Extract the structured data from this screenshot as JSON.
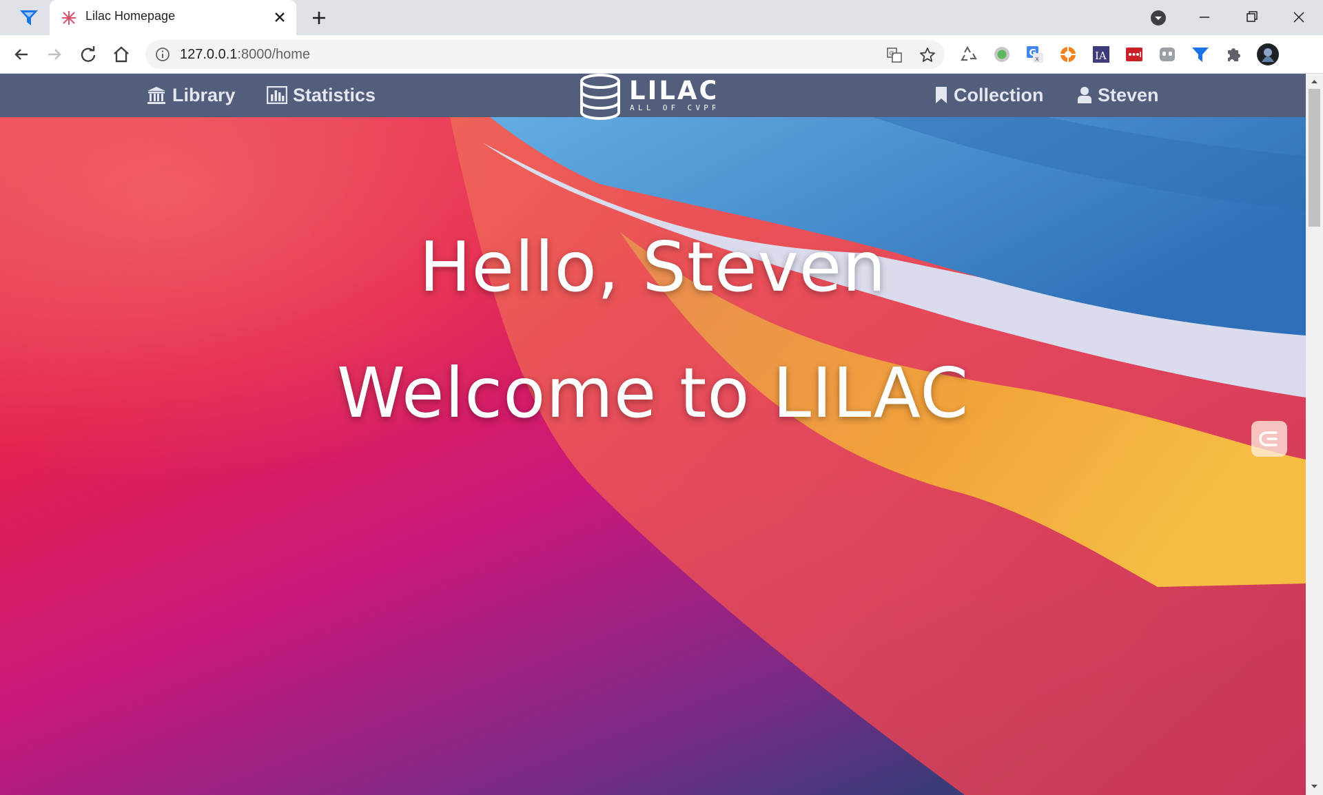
{
  "browser": {
    "tab": {
      "title": "Lilac Homepage"
    },
    "address": {
      "host": "127.0.0.1",
      "rest": ":8000/home"
    }
  },
  "icons": {
    "app": "funnel-icon",
    "favicon": "lilac-favicon-icon",
    "extensions": [
      "recycle-icon",
      "green-circle-icon",
      "google-translate-icon",
      "orange-ring-icon",
      "ia-icon",
      "lastpass-icon",
      "ghostery-icon",
      "funnel-extension-icon",
      "puzzle-icon",
      "profile-avatar-icon"
    ]
  },
  "site": {
    "nav": {
      "library": "Library",
      "statistics": "Statistics",
      "collection": "Collection",
      "user": "Steven"
    },
    "logo": {
      "name": "LILAC",
      "tagline": "ALL OF CVPR"
    },
    "hero": {
      "greeting": "Hello, Steven",
      "welcome": "Welcome to LILAC"
    }
  },
  "colors": {
    "nav_bg": "#535d7c",
    "hero_red": "#e8193f",
    "hero_blue": "#3d85c6",
    "hero_orange": "#f2a33a",
    "hero_purple": "#5a2f80"
  }
}
